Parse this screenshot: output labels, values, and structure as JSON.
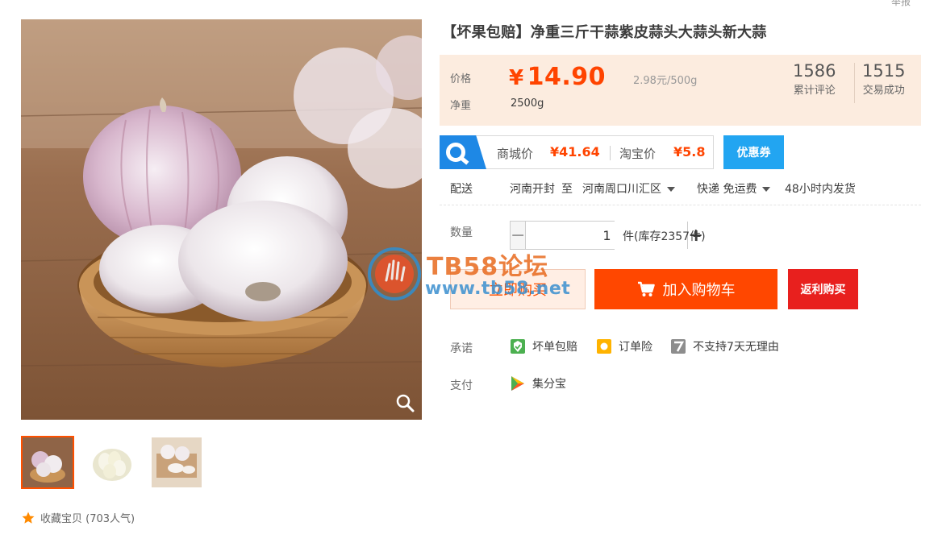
{
  "header": {
    "report_link": "举报"
  },
  "product": {
    "title": "【坏果包赔】净重三斤干蒜紫皮蒜头大蒜头新大蒜"
  },
  "price": {
    "label": "价格",
    "currency": "¥",
    "value": "14.90",
    "unit_price": "2.98元/500g",
    "weight_label": "净重",
    "weight_value": "2500g"
  },
  "stats": {
    "reviews_count": "1586",
    "reviews_label": "累计评论",
    "deals_count": "1515",
    "deals_label": "交易成功"
  },
  "compare": {
    "mall_label": "商城价",
    "mall_price": "¥41.64",
    "taobao_label": "淘宝价",
    "taobao_price": "¥5.8",
    "coupon_label": "优惠券"
  },
  "shipping": {
    "label": "配送",
    "from": "河南开封",
    "to_word": "至",
    "to": "河南周口川汇区",
    "method": "快递 免运费",
    "dispatch": "48小时内发货"
  },
  "quantity": {
    "label": "数量",
    "value": "1",
    "minus": "−",
    "plus": "+",
    "stock": "件(库存2357件)"
  },
  "actions": {
    "buy_now": "立即购买",
    "add_to_cart": "加入购物车",
    "rebate_buy": "返利购买"
  },
  "promises": {
    "label": "承诺",
    "items": [
      "坏单包赔",
      "订单险",
      "不支持7天无理由"
    ]
  },
  "payment": {
    "label": "支付",
    "method": "集分宝"
  },
  "favorite": {
    "label": "收藏宝贝 (703人气)"
  },
  "watermark": {
    "line1": "TB58论坛",
    "line2": "www.tb58.net"
  },
  "colors": {
    "accent": "#ff4400",
    "cart_button": "#ff4700",
    "rebate_button": "#e8201e",
    "coupon_button": "#22a5f1",
    "price_bg": "#fcecdf"
  },
  "icons": {
    "zoom": "magnifier-icon",
    "cart": "shopping-cart-icon",
    "favorite": "star-icon",
    "compare_logo": "q-logo-icon"
  }
}
